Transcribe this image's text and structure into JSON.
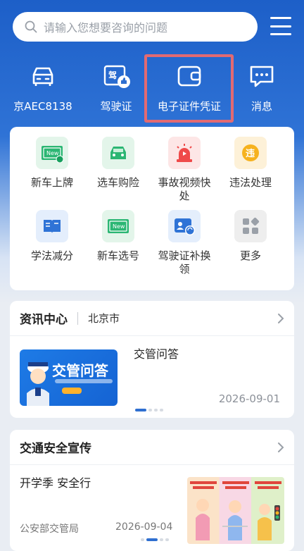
{
  "search": {
    "placeholder": "请输入您想要咨询的问题",
    "icon": "search-icon"
  },
  "menu": {
    "icon": "hamburger-menu-icon"
  },
  "quick": [
    {
      "label": "京AEC8138",
      "icon": "car-icon"
    },
    {
      "label": "驾驶证",
      "icon": "license-icon"
    },
    {
      "label": "电子证件凭证",
      "icon": "wallet-icon",
      "highlighted": true
    },
    {
      "label": "消息",
      "icon": "message-icon"
    }
  ],
  "services": [
    {
      "label": "新车上牌",
      "icon": "new-plate-icon",
      "color": "#e3f5ea"
    },
    {
      "label": "选车购险",
      "icon": "car-insurance-icon",
      "color": "#e3f5ea"
    },
    {
      "label": "事故视频快处",
      "icon": "alarm-icon",
      "color": "#fde6e6"
    },
    {
      "label": "违法处理",
      "icon": "violation-icon",
      "color": "#fdf1d8"
    },
    {
      "label": "学法减分",
      "icon": "book-icon",
      "color": "#e4eefc"
    },
    {
      "label": "新车选号",
      "icon": "new-number-icon",
      "color": "#e3f5ea"
    },
    {
      "label": "驾驶证补换领",
      "icon": "license-renew-icon",
      "color": "#e4eefc"
    },
    {
      "label": "更多",
      "icon": "more-grid-icon",
      "color": "#eeeeee"
    }
  ],
  "news": {
    "title": "资讯中心",
    "city": "北京市",
    "thumb_title": "交管问答",
    "item_title": "交管问答",
    "date": "2026-09-01"
  },
  "safety": {
    "title": "交通安全宣传",
    "item_title": "开学季 安全行",
    "source": "公安部交管局",
    "date": "2026-09-04"
  },
  "colors": {
    "primary": "#1d5fc8",
    "highlight_border": "#e26a72"
  }
}
